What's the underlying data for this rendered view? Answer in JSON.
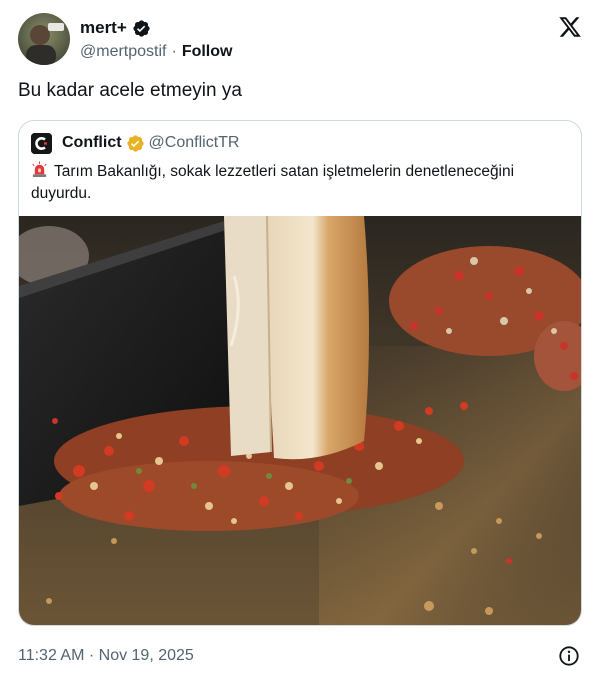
{
  "author": {
    "display_name": "mert+",
    "handle": "@mertpostif",
    "separator": "·",
    "follow_label": "Follow",
    "verified_color": "#0f1419"
  },
  "tweet": {
    "text": "Bu kadar acele etmeyin ya",
    "timestamp": "11:32 AM · Nov 19, 2025"
  },
  "quoted": {
    "display_name": "Conflict",
    "handle": "@ConflictTR",
    "verified_color": "#e8b223",
    "text": "Tarım Bakanlığı, sokak lezzetleri satan işletmelerin denetleneceğini duyurdu.",
    "leading_icon": "police-siren-icon",
    "media_description_icon": "photo"
  },
  "icons": {
    "brand": "x-logo-icon",
    "info": "info-icon"
  },
  "colors": {
    "text_primary": "#0f1419",
    "text_secondary": "#536471",
    "border": "#cfd9de"
  }
}
